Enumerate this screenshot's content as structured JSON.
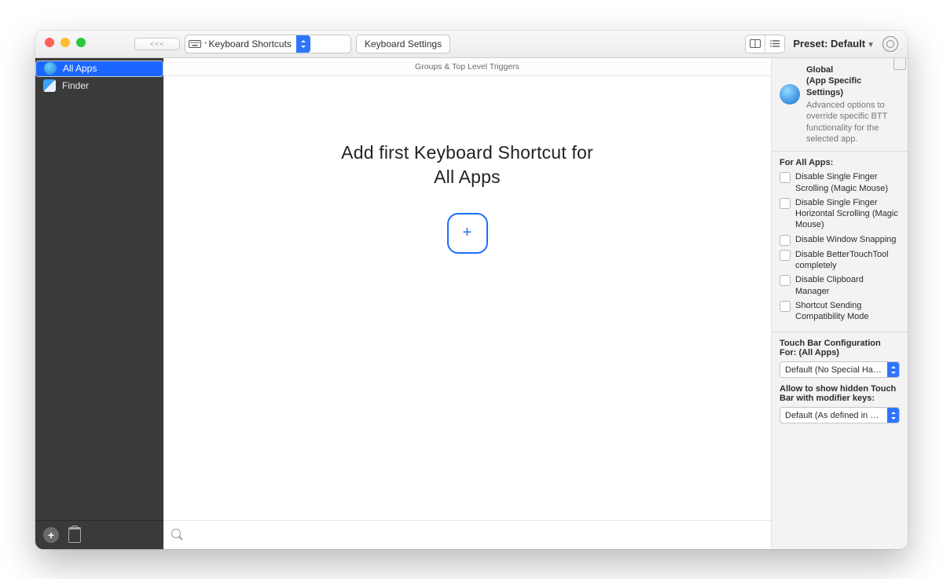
{
  "toolbar": {
    "back_pill": "<<<",
    "dropdown_label": "Keyboard Shortcuts",
    "settings_button": "Keyboard Settings",
    "preset_label": "Preset: Default"
  },
  "sidebar": {
    "items": [
      {
        "label": "All Apps",
        "selected": true
      },
      {
        "label": "Finder",
        "selected": false
      }
    ]
  },
  "main": {
    "header": "Groups & Top Level Triggers",
    "hero_line1": "Add first Keyboard Shortcut for",
    "hero_line2": "All Apps"
  },
  "inspector": {
    "global_title": "Global",
    "global_subtitle": "(App Specific Settings)",
    "global_desc": "Advanced options to override specific BTT functionality for the selected app.",
    "for_all_apps_header": "For All Apps:",
    "checkboxes": [
      "Disable Single Finger Scrolling (Magic Mouse)",
      "Disable Single Finger Horizontal Scrolling (Magic Mouse)",
      "Disable Window Snapping",
      "Disable BetterTouchTool completely",
      "Disable Clipboard Manager",
      "Shortcut Sending Compatibility Mode"
    ],
    "touchbar_header": "Touch Bar Configuration For: (All Apps)",
    "touchbar_select": "Default (No Special Handli…",
    "hidden_header": "Allow to show hidden Touch Bar with modifier keys:",
    "hidden_select": "Default (As defined in setti…"
  }
}
